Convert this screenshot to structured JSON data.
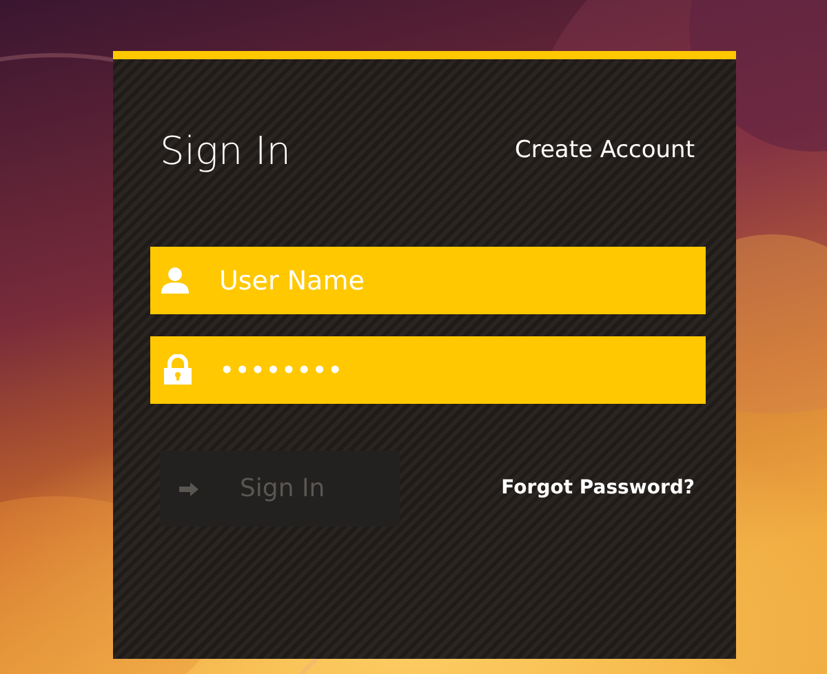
{
  "title": "Sign In",
  "create_account_link": "Create Account",
  "username_field": {
    "placeholder": "User Name"
  },
  "password_field": {
    "value": "••••••••"
  },
  "sign_in_button": {
    "label": "Sign In",
    "disabled": true
  },
  "forgot_password_link": "Forgot Password?"
}
